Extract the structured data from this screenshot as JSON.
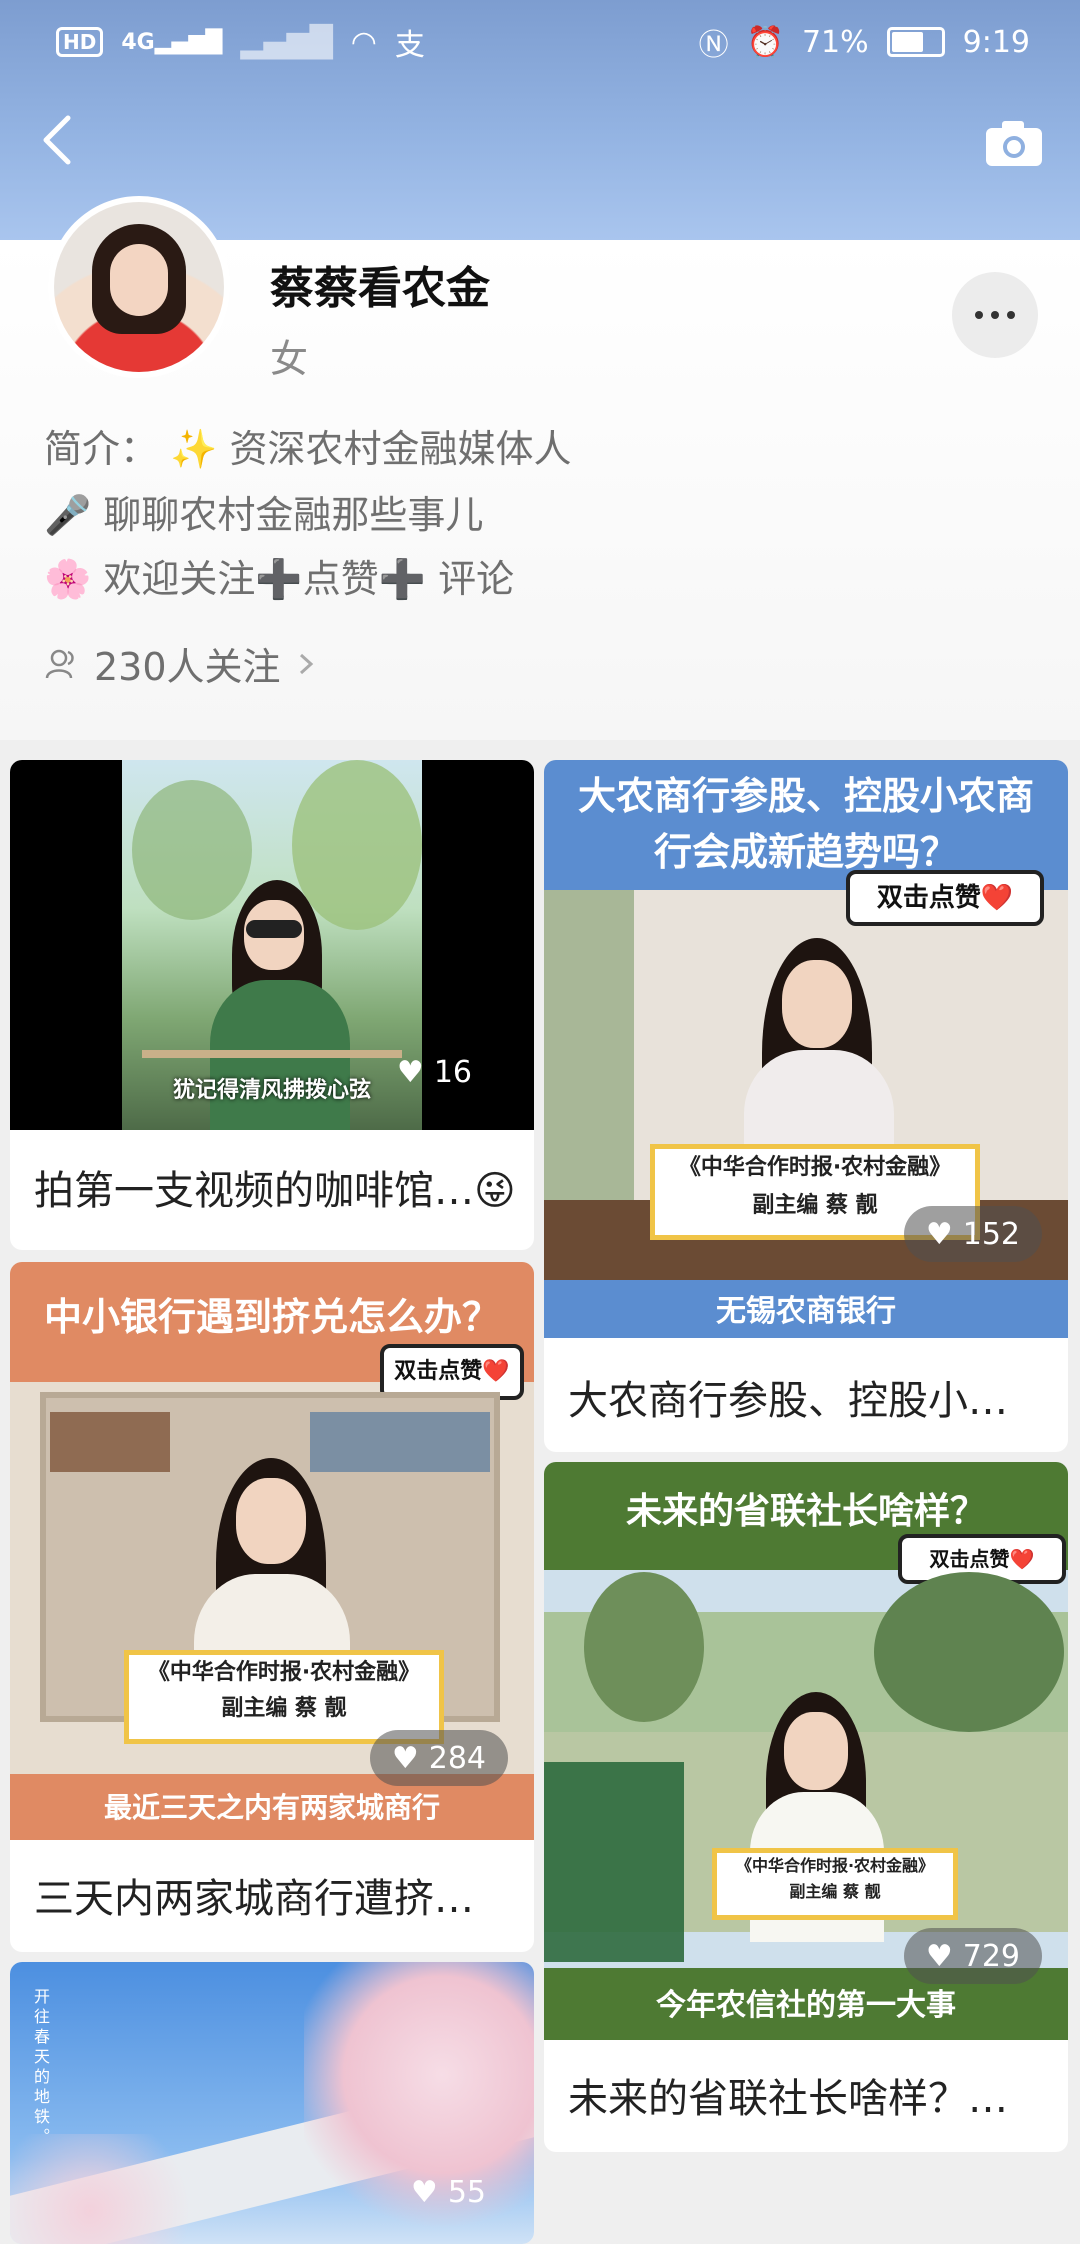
{
  "status_bar": {
    "left_badge": "HD",
    "signal_4g": "4G",
    "right_battery_pct": "71%",
    "time": "9:19",
    "battery_level": 0.71
  },
  "header": {
    "back_icon": "chevron-left-icon",
    "camera_icon": "camera-icon"
  },
  "profile": {
    "name": "蔡蔡看农金",
    "gender": "女",
    "bio_line_1": "简介： ✨ 资深农村金融媒体人",
    "bio_line_2": "🎤 聊聊农村金融那些事儿",
    "bio_line_3": "🌸 欢迎关注➕点赞➕ 评论",
    "followers": "230人关注"
  },
  "cards": [
    {
      "title": "拍第一支视频的咖啡馆…😜",
      "likes": "16",
      "subtitle": "犹记得清风拂拨心弦"
    },
    {
      "title": "大农商行参股、控股小…",
      "likes": "152",
      "banner_top": "大农商行参股、控股小农商行会成新趋势吗？",
      "bubble": "双击点赞❤️",
      "caption_line_1": "《中华合作时报·农村金融》",
      "caption_line_2": "副主编 蔡 靓",
      "banner_bottom": "无锡农商银行"
    },
    {
      "title": "三天内两家城商行遭挤…",
      "likes": "284",
      "banner_top": "中小银行遇到挤兑怎么办？",
      "bubble": "双击点赞❤️",
      "caption_line_1": "《中华合作时报·农村金融》",
      "caption_line_2": "副主编 蔡 靓",
      "banner_bottom": "最近三天之内有两家城商行"
    },
    {
      "title": "未来的省联社长啥样？…",
      "likes": "729",
      "banner_top": "未来的省联社长啥样？",
      "bubble": "双击点赞❤️",
      "caption_line_1": "《中华合作时报·农村金融》",
      "caption_line_2": "副主编 蔡 靓",
      "banner_bottom": "今年农信社的第一大事"
    },
    {
      "likes": "55",
      "overlay_text": "开往春天的地铁。"
    }
  ],
  "colors": {
    "header_blue": "#8fb0e0",
    "banner_orange": "#e08a63",
    "banner_green": "#4e7a33",
    "banner_blue": "#5b8dd0"
  }
}
